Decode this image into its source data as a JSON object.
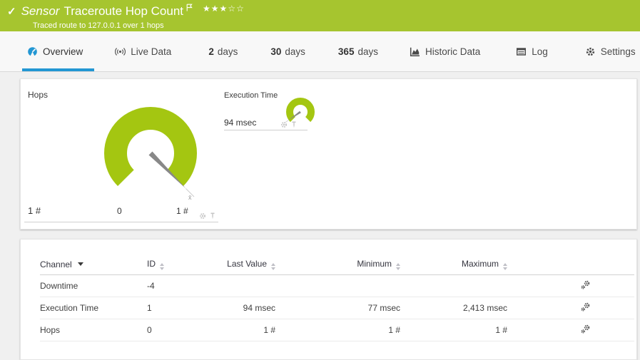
{
  "header": {
    "status_check": "✓",
    "kicker": "Sensor",
    "title": "Traceroute Hop Count",
    "subtitle": "Traced route to 127.0.0.1 over 1 hops",
    "stars_filled": "★★★",
    "stars_empty": "☆☆"
  },
  "tabs": {
    "overview": {
      "label": "Overview"
    },
    "live_data": {
      "label": "Live Data"
    },
    "days2": {
      "num": "2",
      "label": "days"
    },
    "days30": {
      "num": "30",
      "label": "days"
    },
    "days365": {
      "num": "365",
      "label": "days"
    },
    "historic": {
      "label": "Historic Data"
    },
    "log": {
      "label": "Log"
    },
    "settings": {
      "label": "Settings"
    }
  },
  "overview_panel": {
    "hops_gauge": {
      "title": "Hops",
      "current_value": "1 #",
      "scale_min": "0",
      "scale_max": "1 #",
      "avg_marker": "x̄"
    },
    "execution_gauge": {
      "title": "Execution Time",
      "current_value": "94 msec"
    }
  },
  "channel_table": {
    "headers": {
      "channel": "Channel",
      "id": "ID",
      "last_value": "Last Value",
      "minimum": "Minimum",
      "maximum": "Maximum"
    },
    "rows": [
      {
        "channel": "Downtime",
        "id": "-4",
        "last_value": "",
        "minimum": "",
        "maximum": ""
      },
      {
        "channel": "Execution Time",
        "id": "1",
        "last_value": "94 msec",
        "minimum": "77 msec",
        "maximum": "2,413 msec"
      },
      {
        "channel": "Hops",
        "id": "0",
        "last_value": "1 #",
        "minimum": "1 #",
        "maximum": "1 #"
      }
    ]
  },
  "colors": {
    "status_green": "#a6c52f",
    "gauge_green": "#a4c611",
    "accent_blue": "#2397d3"
  }
}
